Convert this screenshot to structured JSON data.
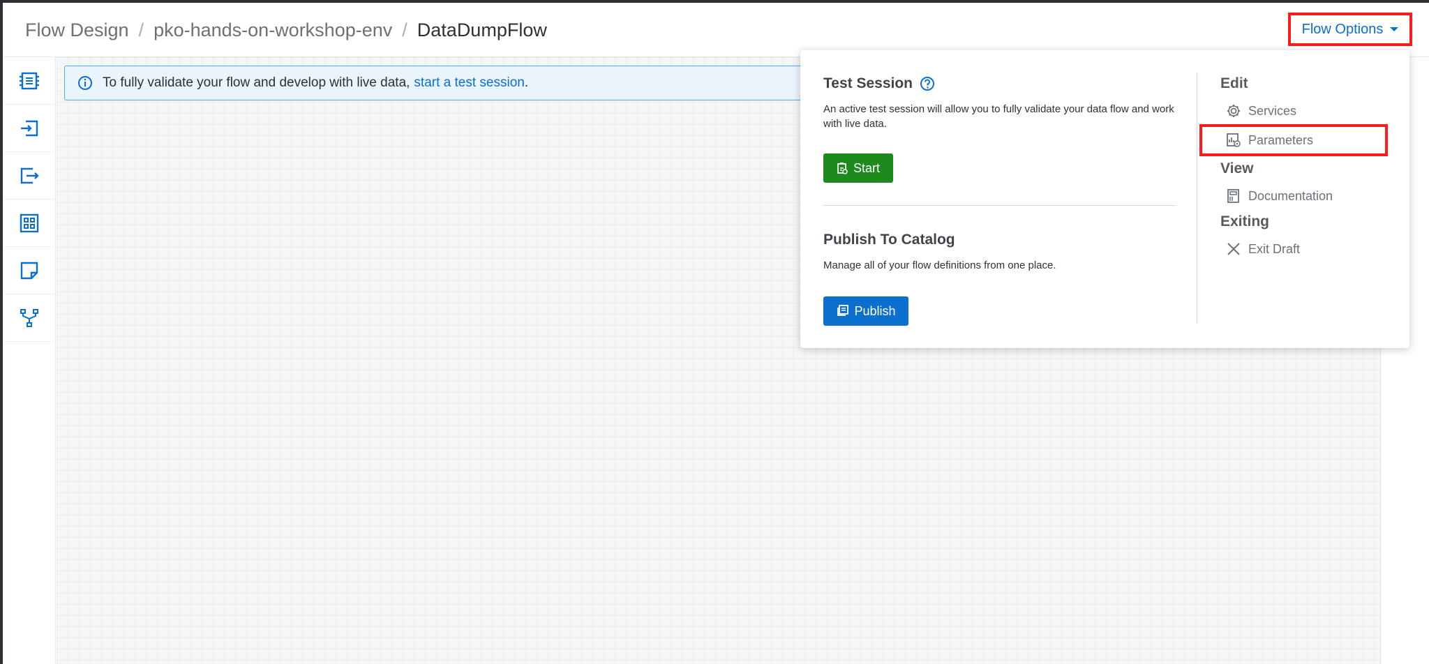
{
  "breadcrumb": {
    "items": [
      "Flow Design",
      "pko-hands-on-workshop-env"
    ],
    "current": "DataDumpFlow"
  },
  "header": {
    "flow_options_label": "Flow Options"
  },
  "toolbar": {
    "tools": [
      "processor-icon",
      "input-port-icon",
      "output-port-icon",
      "process-group-icon",
      "label-icon",
      "funnel-icon"
    ]
  },
  "banner": {
    "text": "To fully validate your flow and develop with live data,",
    "link": "start a test session",
    "suffix": "."
  },
  "panel": {
    "test_session": {
      "title": "Test Session",
      "description": "An active test session will allow you to fully validate your data flow and work with live data.",
      "button": "Start"
    },
    "publish": {
      "title": "Publish To Catalog",
      "description": "Manage all of your flow definitions from one place.",
      "button": "Publish"
    },
    "menu": {
      "edit_heading": "Edit",
      "services": "Services",
      "parameters": "Parameters",
      "view_heading": "View",
      "documentation": "Documentation",
      "exiting_heading": "Exiting",
      "exit_draft": "Exit Draft"
    }
  },
  "colors": {
    "accent": "#0b6fce",
    "start": "#1e8a1e",
    "highlight": "#ff1b1b"
  }
}
